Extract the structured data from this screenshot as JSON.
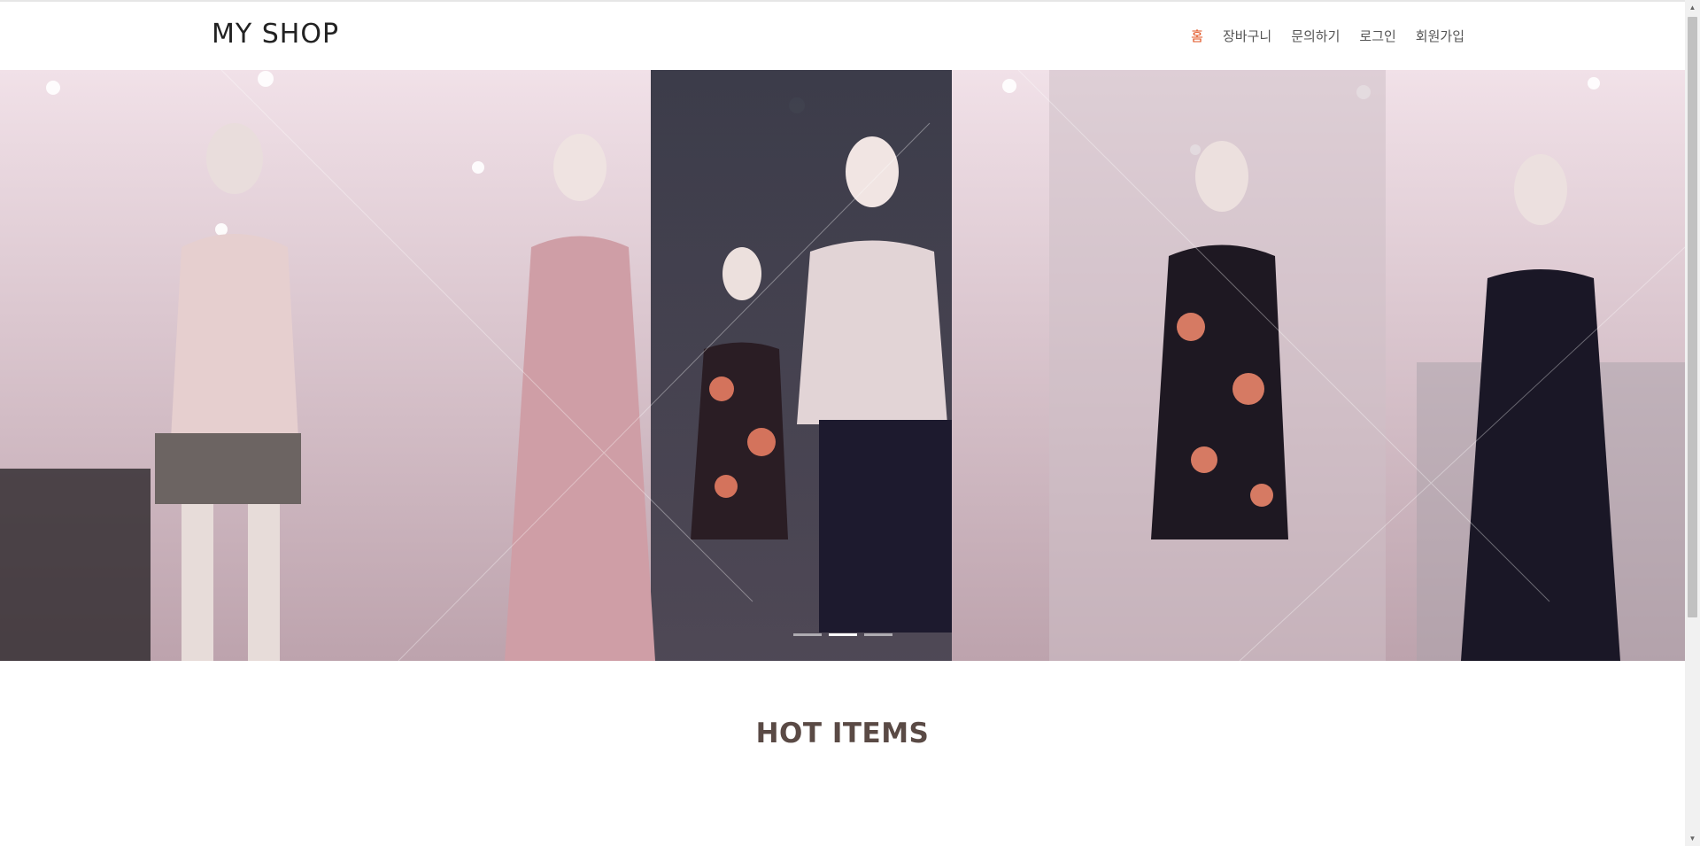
{
  "brand": "MY SHOP",
  "nav": {
    "items": [
      {
        "label": "홈",
        "active": true
      },
      {
        "label": "장바구니",
        "active": false
      },
      {
        "label": "문의하기",
        "active": false
      },
      {
        "label": "로그인",
        "active": false
      },
      {
        "label": "회원가입",
        "active": false
      }
    ]
  },
  "hero": {
    "image": "store-mannequins-photo",
    "slide_count": 3,
    "active_slide": 2
  },
  "section": {
    "title": "HOT ITEMS"
  },
  "colors": {
    "accent": "#e0501f",
    "text": "#555555",
    "title": "#5a4a45"
  }
}
